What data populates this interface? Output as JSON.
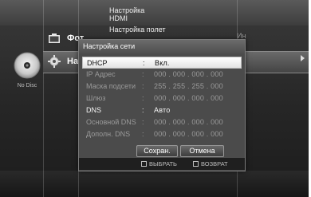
{
  "top_menu": {
    "line1": "Настройка",
    "line2": "HDMI",
    "line3": "Настройка полет"
  },
  "disc": {
    "label": "No Disc"
  },
  "menu": {
    "row1_label": "Фот",
    "row2_label": "Нас"
  },
  "right_ghost": "Ин",
  "dialog": {
    "title": "Настройка сети",
    "rows": [
      {
        "key": "DHCP",
        "colon": ":",
        "value": "Вкл."
      },
      {
        "key": "IP Адрес",
        "colon": ":",
        "value": "000 .  000 .  000 .  000"
      },
      {
        "key": "Маска подсети",
        "colon": ":",
        "value": "255 .  255 .  255 .  000"
      },
      {
        "key": "Шлюз",
        "colon": ":",
        "value": "000 .  000 .  000 .  000"
      },
      {
        "key": "DNS",
        "colon": ":",
        "value": "Авто"
      },
      {
        "key": "Основной DNS",
        "colon": ":",
        "value": "000 .  000 .  000 .  000"
      },
      {
        "key": "Дополн. DNS",
        "colon": ":",
        "value": "000 .  000 .  000 .  000"
      }
    ],
    "save_label": "Сохран.",
    "cancel_label": "Отмена",
    "footer_select": "ВЫБРАТЬ",
    "footer_return": "ВОЗВРАТ"
  }
}
